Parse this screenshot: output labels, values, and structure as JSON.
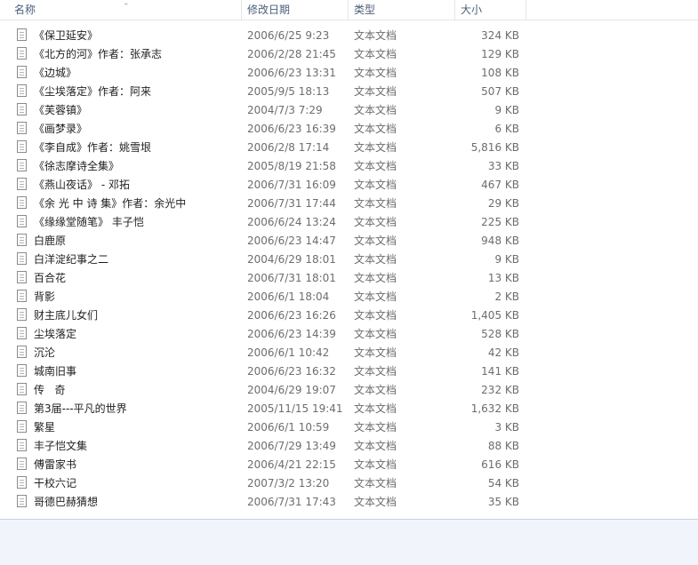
{
  "columns": {
    "name": "名称",
    "date": "修改日期",
    "type": "类型",
    "size": "大小"
  },
  "files": [
    {
      "name": "《保卫延安》",
      "date": "2006/6/25 9:23",
      "type": "文本文档",
      "size": "324 KB"
    },
    {
      "name": "《北方的河》作者：张承志",
      "date": "2006/2/28 21:45",
      "type": "文本文档",
      "size": "129 KB"
    },
    {
      "name": "《边城》",
      "date": "2006/6/23 13:31",
      "type": "文本文档",
      "size": "108 KB"
    },
    {
      "name": "《尘埃落定》作者：阿来",
      "date": "2005/9/5 18:13",
      "type": "文本文档",
      "size": "507 KB"
    },
    {
      "name": "《芙蓉镇》",
      "date": "2004/7/3 7:29",
      "type": "文本文档",
      "size": "9 KB"
    },
    {
      "name": "《画梦录》",
      "date": "2006/6/23 16:39",
      "type": "文本文档",
      "size": "6 KB"
    },
    {
      "name": "《李自成》作者：姚雪垠",
      "date": "2006/2/8 17:14",
      "type": "文本文档",
      "size": "5,816 KB"
    },
    {
      "name": "《徐志摩诗全集》",
      "date": "2005/8/19 21:58",
      "type": "文本文档",
      "size": "33 KB"
    },
    {
      "name": "《燕山夜话》 - 邓拓",
      "date": "2006/7/31 16:09",
      "type": "文本文档",
      "size": "467 KB"
    },
    {
      "name": "《余 光 中 诗 集》作者：余光中",
      "date": "2006/7/31 17:44",
      "type": "文本文档",
      "size": "29 KB"
    },
    {
      "name": "《缘缘堂随笔》 丰子恺",
      "date": "2006/6/24 13:24",
      "type": "文本文档",
      "size": "225 KB"
    },
    {
      "name": "白鹿原",
      "date": "2006/6/23 14:47",
      "type": "文本文档",
      "size": "948 KB"
    },
    {
      "name": "白洋淀纪事之二",
      "date": "2004/6/29 18:01",
      "type": "文本文档",
      "size": "9 KB"
    },
    {
      "name": "百合花",
      "date": "2006/7/31 18:01",
      "type": "文本文档",
      "size": "13 KB"
    },
    {
      "name": "背影",
      "date": "2006/6/1 18:04",
      "type": "文本文档",
      "size": "2 KB"
    },
    {
      "name": "财主底儿女们",
      "date": "2006/6/23 16:26",
      "type": "文本文档",
      "size": "1,405 KB"
    },
    {
      "name": "尘埃落定",
      "date": "2006/6/23 14:39",
      "type": "文本文档",
      "size": "528 KB"
    },
    {
      "name": "沉沦",
      "date": "2006/6/1 10:42",
      "type": "文本文档",
      "size": "42 KB"
    },
    {
      "name": "城南旧事",
      "date": "2006/6/23 16:32",
      "type": "文本文档",
      "size": "141 KB"
    },
    {
      "name": "传   奇",
      "date": "2004/6/29 19:07",
      "type": "文本文档",
      "size": "232 KB"
    },
    {
      "name": "第3届---平凡的世界",
      "date": "2005/11/15 19:41",
      "type": "文本文档",
      "size": "1,632 KB"
    },
    {
      "name": "繁星",
      "date": "2006/6/1 10:59",
      "type": "文本文档",
      "size": "3 KB"
    },
    {
      "name": "丰子恺文集",
      "date": "2006/7/29 13:49",
      "type": "文本文档",
      "size": "88 KB"
    },
    {
      "name": "傅雷家书",
      "date": "2006/4/21 22:15",
      "type": "文本文档",
      "size": "616 KB"
    },
    {
      "name": "干校六记",
      "date": "2007/3/2 13:20",
      "type": "文本文档",
      "size": "54 KB"
    },
    {
      "name": "哥德巴赫猜想",
      "date": "2006/7/31 17:43",
      "type": "文本文档",
      "size": "35 KB"
    }
  ]
}
